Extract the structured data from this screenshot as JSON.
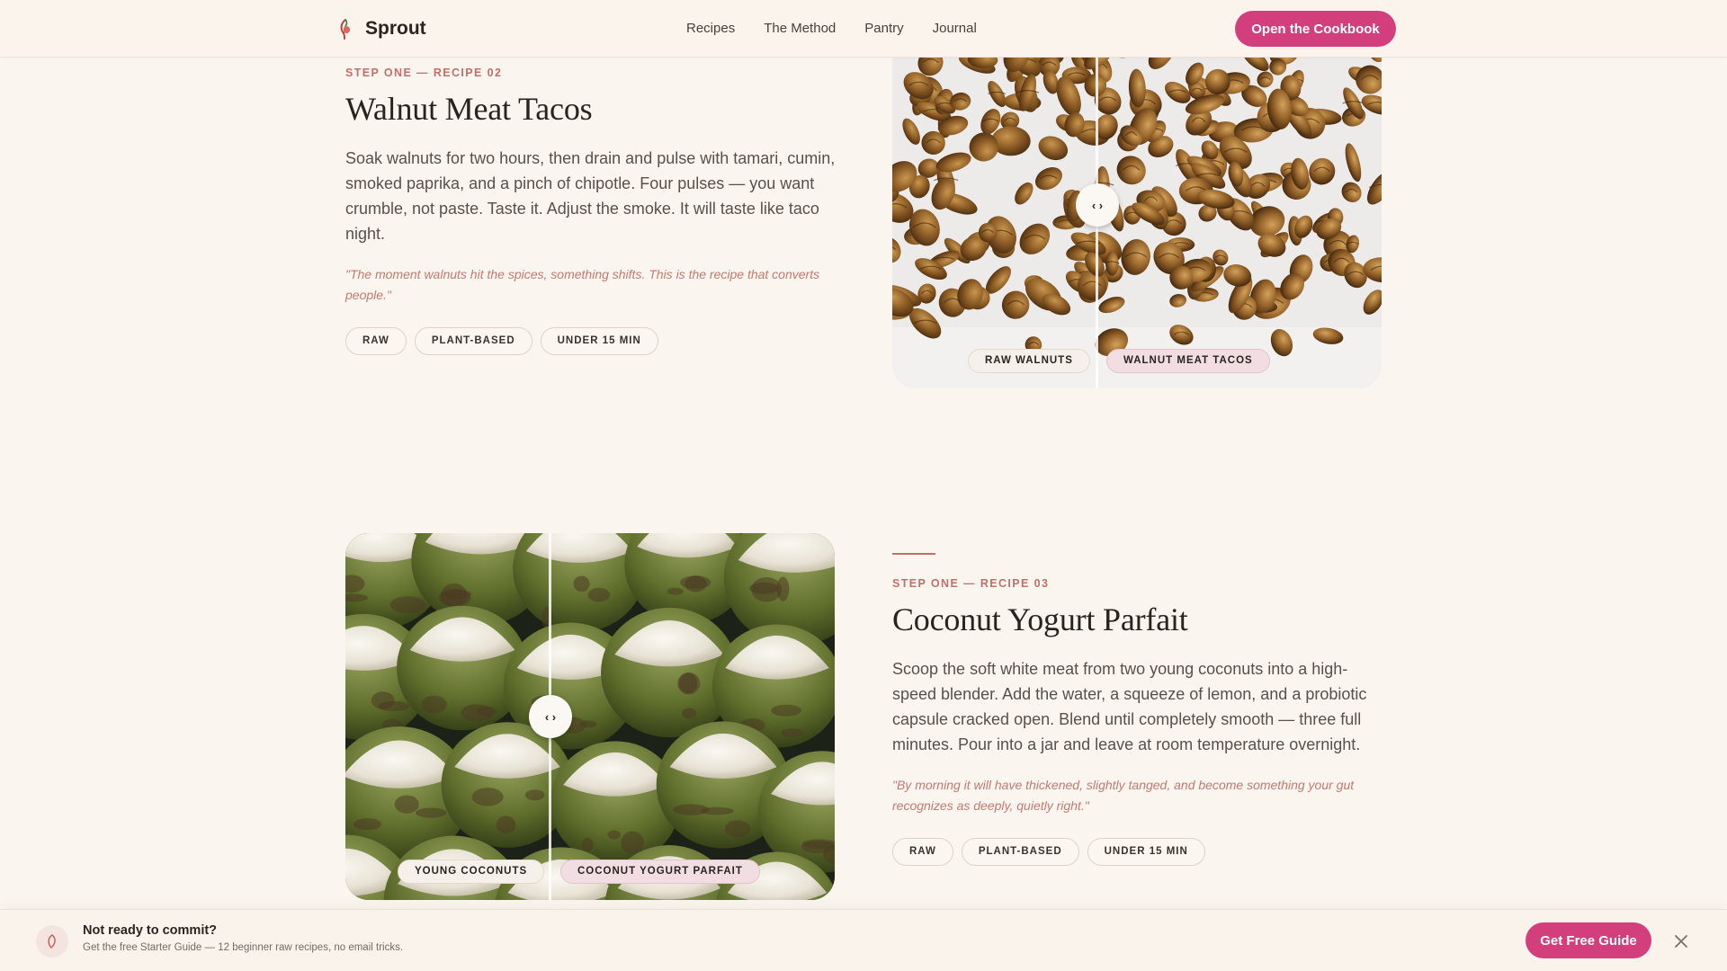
{
  "header": {
    "brand": "Sprout",
    "nav": [
      "Recipes",
      "The Method",
      "Pantry",
      "Journal"
    ],
    "cta_label": "Open the Cookbook"
  },
  "recipes": [
    {
      "eyebrow": "STEP ONE — RECIPE 02",
      "title": "Walnut Meat Tacos",
      "description": "Soak walnuts for two hours, then drain and pulse with tamari, cumin, smoked paprika, and a pinch of chipotle. Four pulses — you want crumble, not paste. Taste it. Adjust the smoke. It will taste like taco night.",
      "quote": "\"The moment walnuts hit the spices, something shifts. This is the recipe that converts people.\"",
      "tags": [
        "RAW",
        "PLANT-BASED",
        "UNDER 15 MIN"
      ],
      "compare": {
        "before_label": "RAW WALNUTS",
        "after_label": "WALNUT MEAT TACOS",
        "handle": "‹ ›"
      }
    },
    {
      "eyebrow": "STEP ONE — RECIPE 03",
      "title": "Coconut Yogurt Parfait",
      "description": "Scoop the soft white meat from two young coconuts into a high-speed blender. Add the water, a squeeze of lemon, and a probiotic capsule cracked open. Blend until completely smooth — three full minutes. Pour into a jar and leave at room temperature overnight.",
      "quote": "\"By morning it will have thickened, slightly tanged, and become something your gut recognizes as deeply, quietly right.\"",
      "tags": [
        "RAW",
        "PLANT-BASED",
        "UNDER 15 MIN"
      ],
      "compare": {
        "before_label": "YOUNG COCONUTS",
        "after_label": "COCONUT YOGURT PARFAIT",
        "handle": "‹ ›"
      }
    }
  ],
  "banner": {
    "title": "Not ready to commit?",
    "subtitle": "Get the free Starter Guide — 12 beginner raw recipes, no email tricks.",
    "button_label": "Get Free Guide"
  },
  "colors": {
    "accent": "#d23f7c",
    "eyebrow": "#c0706a",
    "background": "#faf5ef"
  },
  "icons": [
    "sprout-logo-icon",
    "leaf-icon",
    "close-icon",
    "drag-handle-icon"
  ]
}
